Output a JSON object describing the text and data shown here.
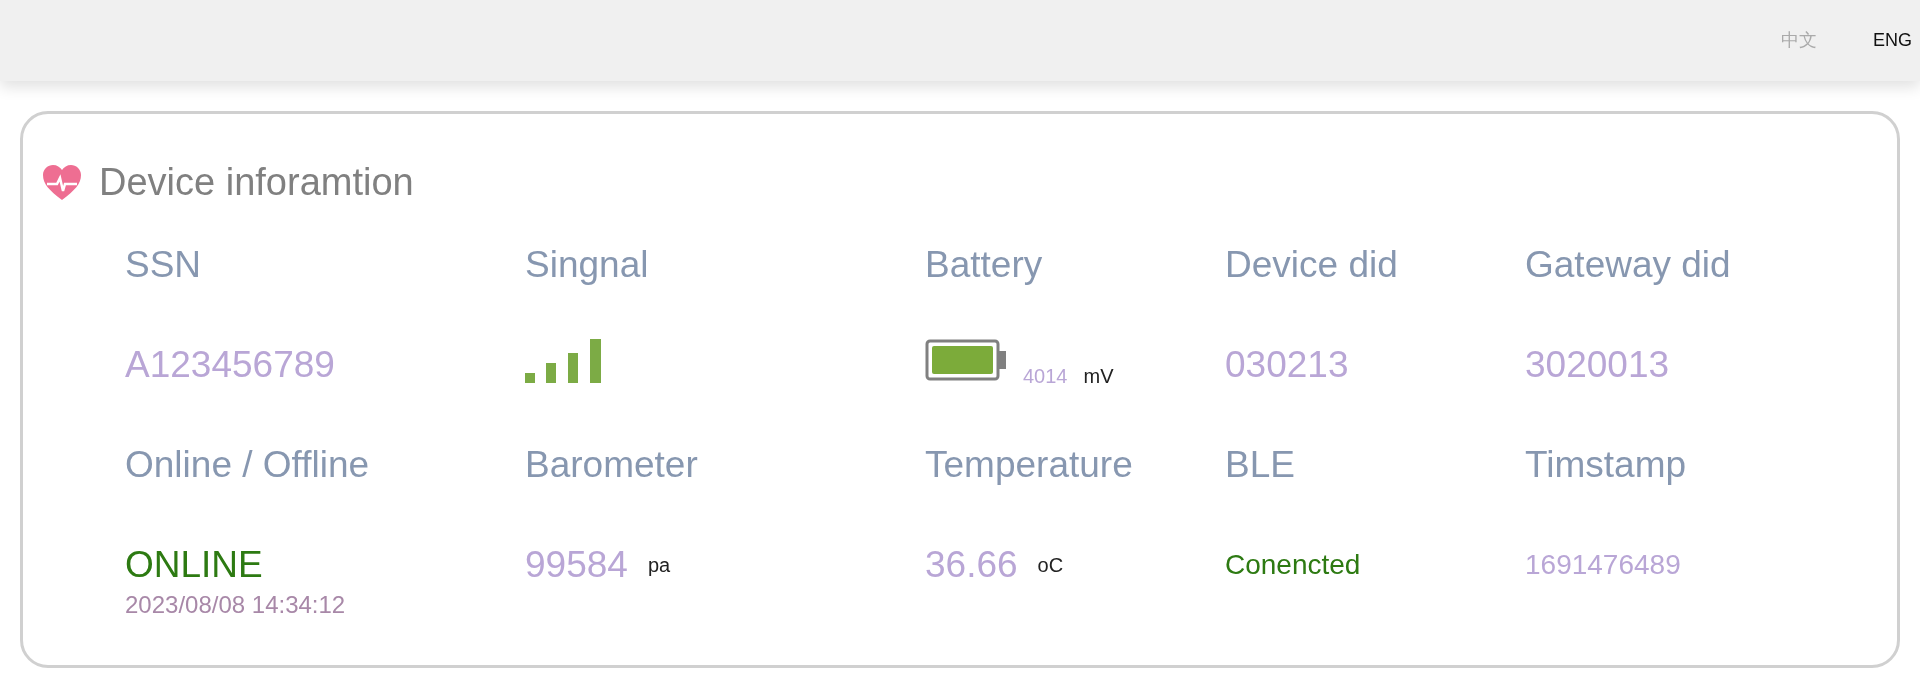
{
  "languages": [
    {
      "label": "中文",
      "selected": false
    },
    {
      "label": "ENG",
      "selected": true
    }
  ],
  "card": {
    "title": "Device inforamtion",
    "fields": [
      {
        "label": "SSN",
        "kind": "value",
        "value": "A123456789"
      },
      {
        "label": "Singnal",
        "kind": "signal"
      },
      {
        "label": "Battery",
        "kind": "battery",
        "value": "4014",
        "unit": "mV"
      },
      {
        "label": "Device did",
        "kind": "value",
        "value": "030213"
      },
      {
        "label": "Gateway did",
        "kind": "value",
        "value": "3020013"
      },
      {
        "label": "Online / Offline",
        "kind": "status",
        "value": "ONLINE",
        "note": "2023/08/08 14:34:12"
      },
      {
        "label": "Barometer",
        "kind": "value",
        "value": "99584",
        "unit": "pa"
      },
      {
        "label": "Temperature",
        "kind": "value",
        "value": "36.66",
        "unit": "oC"
      },
      {
        "label": "BLE",
        "kind": "state",
        "value": "Conencted"
      },
      {
        "label": "Timstamp",
        "kind": "number",
        "value": "1691476489"
      }
    ]
  }
}
